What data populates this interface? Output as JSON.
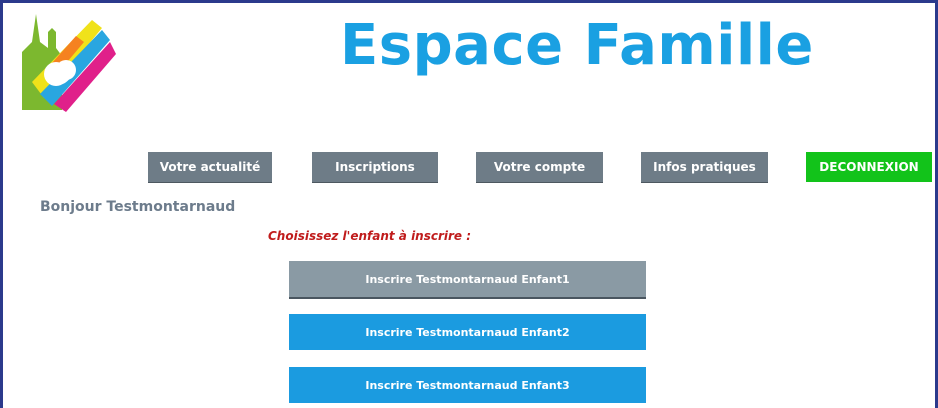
{
  "header": {
    "title": "Espace Famille",
    "logo_icon": "city-logo-icon"
  },
  "nav": {
    "items": [
      {
        "label": "Votre actualité"
      },
      {
        "label": "Inscriptions"
      },
      {
        "label": "Votre compte"
      },
      {
        "label": "Infos pratiques"
      },
      {
        "label": "DECONNEXION"
      }
    ]
  },
  "main": {
    "greeting": "Bonjour Testmontarnaud",
    "prompt": "Choisissez l'enfant à inscrire :",
    "children": [
      {
        "label": "Inscrire Testmontarnaud Enfant1",
        "state": "selected"
      },
      {
        "label": "Inscrire Testmontarnaud Enfant2",
        "state": "normal"
      },
      {
        "label": "Inscrire Testmontarnaud Enfant3",
        "state": "normal"
      }
    ]
  },
  "colors": {
    "title": "#1aa0e2",
    "nav_button": "#6e7c87",
    "logout_button": "#12c31a",
    "child_selected": "#8a9aa4",
    "child_button": "#1b9be0",
    "prompt_text": "#c01c1c",
    "frame": "#2b3a8c"
  }
}
